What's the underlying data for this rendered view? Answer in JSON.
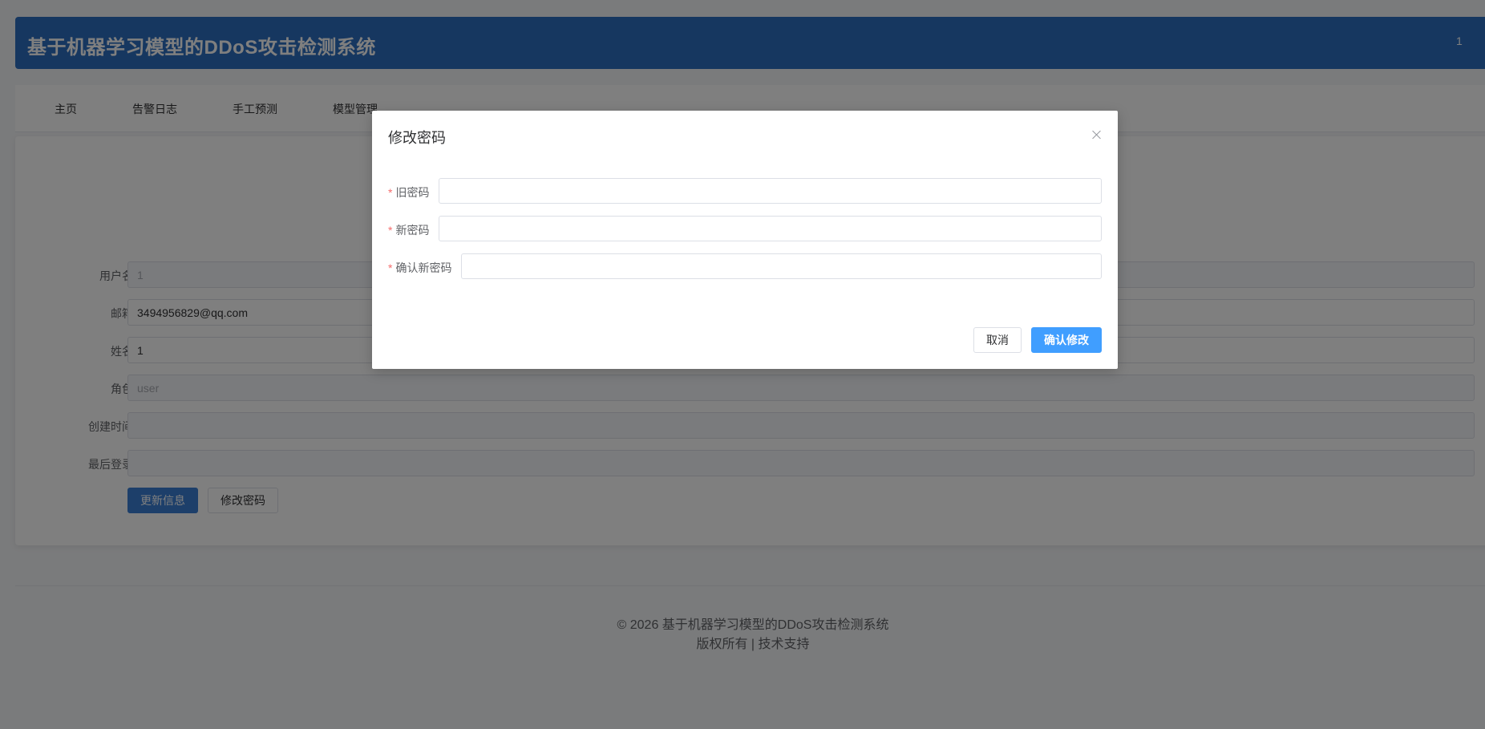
{
  "header": {
    "title": "基于机器学习模型的DDoS攻击检测系统",
    "user": "1"
  },
  "nav": {
    "items": [
      {
        "label": "主页"
      },
      {
        "label": "告警日志"
      },
      {
        "label": "手工预测"
      },
      {
        "label": "模型管理"
      }
    ]
  },
  "profile": {
    "fields": [
      {
        "label": "用户名",
        "value": "1",
        "disabled": true
      },
      {
        "label": "邮箱",
        "value": "3494956829@qq.com",
        "disabled": false
      },
      {
        "label": "姓名",
        "value": "1",
        "disabled": false
      },
      {
        "label": "角色",
        "value": "user",
        "disabled": true
      },
      {
        "label": "创建时间",
        "value": "",
        "disabled": true
      },
      {
        "label": "最后登录",
        "value": "",
        "disabled": true
      }
    ],
    "update_button": "更新信息",
    "change_password_button": "修改密码"
  },
  "footer": {
    "copyright": "© 2026 基于机器学习模型的DDoS攻击检测系统",
    "links": "版权所有 | 技术支持"
  },
  "dialog": {
    "title": "修改密码",
    "fields": [
      {
        "label": "旧密码",
        "value": ""
      },
      {
        "label": "新密码",
        "value": ""
      },
      {
        "label": "确认新密码",
        "value": ""
      }
    ],
    "cancel_button": "取消",
    "confirm_button": "确认修改"
  }
}
